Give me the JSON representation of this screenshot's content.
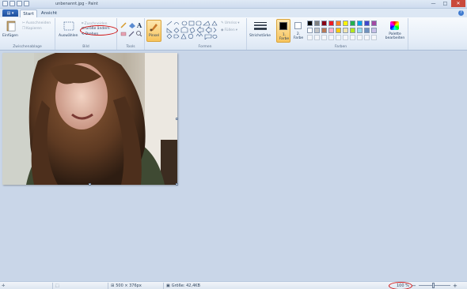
{
  "window": {
    "title": "unbenannt.jpg - Paint"
  },
  "tabs": {
    "file": "▤ ▾",
    "start": "Start",
    "view": "Ansicht",
    "help": "?"
  },
  "window_buttons": {
    "minimize": "—",
    "maximize": "□",
    "close": "✕"
  },
  "ribbon": {
    "clipboard": {
      "paste": "Einfügen",
      "cut": "Ausschneiden",
      "copy": "Kopieren",
      "label": "Zwischenablage"
    },
    "image": {
      "select": "Auswählen",
      "crop": "Zuschneiden",
      "resize": "Größe ändern",
      "rotate": "Drehen",
      "label": "Bild"
    },
    "tools": {
      "label": "Tools",
      "text_tool": "A"
    },
    "brush": {
      "label": "Pinsel"
    },
    "shapes": {
      "outline": "Umriss",
      "fill": "Füllen",
      "label": "Formen"
    },
    "stroke": {
      "label": "Strichstärke"
    },
    "colors": {
      "color1": "1. Farbe",
      "color2": "2. Farbe",
      "edit": "Palette bearbeiten",
      "label": "Farben",
      "palette_row1": [
        "#000000",
        "#7f7f7f",
        "#880015",
        "#ed1c24",
        "#ff7f27",
        "#fff200",
        "#22b14c",
        "#00a2e8",
        "#3f48cc",
        "#a349a4"
      ],
      "palette_row2": [
        "#ffffff",
        "#c3c3c3",
        "#b97a57",
        "#ffaec9",
        "#ffc90e",
        "#efe4b0",
        "#b5e61d",
        "#99d9ea",
        "#7092be",
        "#c8bfe7"
      ]
    }
  },
  "status": {
    "dimensions": "500 × 376px",
    "filesize": "Größe: 42,4KB",
    "zoom": "100 %",
    "zoom_out": "−",
    "zoom_in": "+"
  }
}
